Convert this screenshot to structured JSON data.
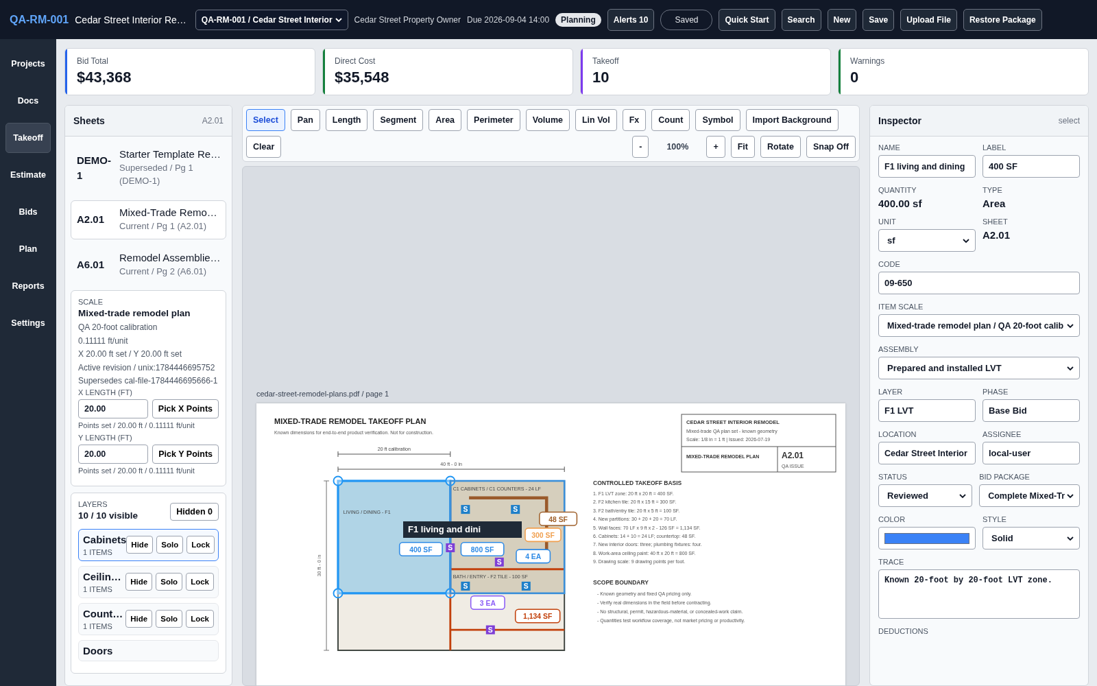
{
  "header": {
    "project_code": "QA-RM-001",
    "project_title": "Cedar Street Interior Re…",
    "project_select": "QA-RM-001 / Cedar Street Interior",
    "owner": "Cedar Street Property Owner",
    "due": "Due 2026-09-04 14:00",
    "phase_badge": "Planning",
    "alerts": "Alerts 10",
    "save_state": "Saved",
    "actions": [
      "Quick Start",
      "Search",
      "New",
      "Save",
      "Upload File",
      "Restore Package"
    ]
  },
  "nav": [
    {
      "label": "Projects",
      "selected": false
    },
    {
      "label": "Docs",
      "selected": false
    },
    {
      "label": "Takeoff",
      "selected": true
    },
    {
      "label": "Estimate",
      "selected": false
    },
    {
      "label": "Bids",
      "selected": false
    },
    {
      "label": "Plan",
      "selected": false
    },
    {
      "label": "Reports",
      "selected": false
    },
    {
      "label": "Settings",
      "selected": false
    }
  ],
  "kpis": [
    {
      "label": "Bid Total",
      "value": "$43,368",
      "color": "#2563eb"
    },
    {
      "label": "Direct Cost",
      "value": "$35,548",
      "color": "#15803d"
    },
    {
      "label": "Takeoff",
      "value": "10",
      "color": "#7c3aed"
    },
    {
      "label": "Warnings",
      "value": "0",
      "color": "#15803d"
    }
  ],
  "sheets": {
    "title": "Sheets",
    "current": "A2.01",
    "items": [
      {
        "code": "DEMO-1",
        "title": "Starter Template Re…",
        "meta": "Superseded / Pg 1 (DEMO-1)",
        "selected": false
      },
      {
        "code": "A2.01",
        "title": "Mixed-Trade Remo…",
        "meta": "Current / Pg 1 (A2.01)",
        "selected": true
      },
      {
        "code": "A6.01",
        "title": "Remodel Assemblie…",
        "meta": "Current / Pg 2 (A6.01)",
        "selected": false
      }
    ]
  },
  "scale": {
    "label": "SCALE",
    "name": "Mixed-trade remodel plan",
    "lines": [
      "QA 20-foot calibration",
      "0.11111 ft/unit",
      "X 20.00 ft set / Y 20.00 ft set",
      "Active revision / unix:1784446695752",
      "Supersedes cal-file-1784446695666-1"
    ],
    "axes": [
      {
        "label": "X LENGTH (FT)",
        "value": "20.00",
        "button": "Pick X Points",
        "status": "Points set / 20.00 ft / 0.11111 ft/unit"
      },
      {
        "label": "Y LENGTH (FT)",
        "value": "20.00",
        "button": "Pick Y Points",
        "status": "Points set / 20.00 ft / 0.11111 ft/unit"
      }
    ]
  },
  "layers": {
    "label": "LAYERS",
    "count": "10 / 10 visible",
    "hidden_button": "Hidden 0",
    "items": [
      {
        "name": "Cabinets",
        "count": "1 ITEMS",
        "selected": true,
        "actions": [
          "Hide",
          "Solo",
          "Lock"
        ]
      },
      {
        "name": "Ceilin…",
        "count": "1 ITEMS",
        "selected": false,
        "actions": [
          "Hide",
          "Solo",
          "Lock"
        ]
      },
      {
        "name": "Count…",
        "count": "1 ITEMS",
        "selected": false,
        "actions": [
          "Hide",
          "Solo",
          "Lock"
        ]
      },
      {
        "name": "Doors",
        "selected": false
      }
    ]
  },
  "toolbar": {
    "tools": [
      {
        "label": "Select",
        "selected": true
      },
      {
        "label": "Pan",
        "selected": false
      },
      {
        "label": "Length",
        "selected": false
      },
      {
        "label": "Segment",
        "selected": false
      },
      {
        "label": "Area",
        "selected": false
      },
      {
        "label": "Perimeter",
        "selected": false
      },
      {
        "label": "Volume",
        "selected": false
      },
      {
        "label": "Lin Vol",
        "selected": false
      },
      {
        "label": "Fx",
        "selected": false
      },
      {
        "label": "Count",
        "selected": false
      },
      {
        "label": "Symbol",
        "selected": false
      },
      {
        "label": "Import Background",
        "selected": false
      }
    ],
    "clear": "Clear",
    "zoom_out": "-",
    "zoom": "100%",
    "zoom_in": "+",
    "view_actions": [
      "Fit",
      "Rotate",
      "Snap Off"
    ]
  },
  "document": {
    "file": "cedar-street-remodel-plans.pdf / page 1",
    "title": "MIXED-TRADE REMODEL TAKEOFF PLAN",
    "subtitle": "Known dimensions for end-to-end product verification. Not for construction.",
    "dimensions": {
      "calibration": "20 ft calibration",
      "width": "40 ft - 0 in",
      "height": "30 ft - 0 in"
    },
    "room_labels": [
      "LIVING / DINING - F1",
      "C1 CABINETS / C1 COUNTERS - 24 LF",
      "BATH / ENTRY - F2 TILE - 100 SF"
    ],
    "title_block": {
      "project": "CEDAR STREET INTERIOR REMODEL",
      "subtitle": "Mixed-trade QA plan set - known geometry",
      "scale": "Scale: 1/8 in = 1 ft | Issued: 2026-07-19",
      "sheet_title": "MIXED-TRADE REMODEL PLAN",
      "sheet_number": "A2.01",
      "issue": "QA ISSUE"
    },
    "notes": {
      "title": "CONTROLLED TAKEOFF BASIS",
      "items": [
        "1. F1 LVT zone: 20 ft x 20 ft = 400 SF.",
        "2. F2 kitchen tile: 20 ft x 15 ft = 300 SF.",
        "3. F2 bath/entry tile: 20 ft x 5 ft = 100 SF.",
        "4. New partitions: 30 + 20 + 20 = 70 LF.",
        "5. Wall faces: 70 LF x 9 ft x 2 - 126 SF = 1,134 SF.",
        "6. Cabinets: 14 + 10 = 24 LF; countertop: 48 SF.",
        "7. New interior doors: three; plumbing fixtures: four.",
        "8. Work-area ceiling paint: 40 ft x 20 ft = 800 SF.",
        "9. Drawing scale: 9 drawing points per foot."
      ]
    },
    "scope": {
      "title": "SCOPE BOUNDARY",
      "items": [
        "- Known geometry and fixed QA pricing only.",
        "- Verify real dimensions in the field before contracting.",
        "- No structural, permit, hazardous-material, or concealed-work claim.",
        "- Quantities test workflow coverage, not market pricing or productivity."
      ]
    },
    "markups": [
      {
        "label": "400 SF",
        "color": "#2f8be6"
      },
      {
        "label": "800 SF",
        "color": "#2f8be6"
      },
      {
        "label": "4 EA",
        "color": "#2f8be6"
      },
      {
        "label": "48 SF",
        "color": "#a0622d"
      },
      {
        "label": "300 SF",
        "color": "#f0a050"
      },
      {
        "label": "3 EA",
        "color": "#8b5cf6"
      },
      {
        "label": "1,134 SF",
        "color": "#c2410c"
      }
    ],
    "symbols": [
      {
        "text": "S",
        "color": "#1e7fc9"
      },
      {
        "text": "S",
        "color": "#1e7fc9"
      },
      {
        "text": "S",
        "color": "#1e7fc9"
      },
      {
        "text": "S",
        "color": "#1e7fc9"
      },
      {
        "text": "S",
        "color": "#7e3fd6"
      },
      {
        "text": "S",
        "color": "#7e3fd6"
      },
      {
        "text": "S",
        "color": "#7e3fd6"
      }
    ],
    "tooltip": "F1 living and dini"
  },
  "inspector": {
    "title": "Inspector",
    "mode": "select",
    "rows": [
      [
        {
          "kind": "input",
          "label": "NAME",
          "value": "F1 living and dining"
        },
        {
          "kind": "input",
          "label": "LABEL",
          "value": "400 SF"
        }
      ],
      [
        {
          "kind": "static",
          "label": "QUANTITY",
          "value": "400.00 sf"
        },
        {
          "kind": "static",
          "label": "TYPE",
          "value": "Area"
        }
      ],
      [
        {
          "kind": "select",
          "label": "UNIT",
          "value": "sf"
        },
        {
          "kind": "static",
          "label": "SHEET",
          "value": "A2.01"
        }
      ],
      [
        {
          "kind": "input",
          "label": "CODE",
          "value": "09-650"
        }
      ],
      [
        {
          "kind": "select",
          "label": "ITEM SCALE",
          "value": "Mixed-trade remodel plan / QA 20-foot calib"
        }
      ],
      [
        {
          "kind": "select",
          "label": "ASSEMBLY",
          "value": "Prepared and installed LVT"
        }
      ],
      [
        {
          "kind": "input",
          "label": "LAYER",
          "value": "F1 LVT"
        },
        {
          "kind": "input",
          "label": "PHASE",
          "value": "Base Bid"
        }
      ],
      [
        {
          "kind": "input",
          "label": "LOCATION",
          "value": "Cedar Street Interior"
        },
        {
          "kind": "input",
          "label": "ASSIGNEE",
          "value": "local-user"
        }
      ],
      [
        {
          "kind": "select",
          "label": "STATUS",
          "value": "Reviewed"
        },
        {
          "kind": "select",
          "label": "BID PACKAGE",
          "value": "Complete Mixed-Tr"
        }
      ],
      [
        {
          "kind": "color",
          "label": "COLOR",
          "color": "#3b82f6"
        },
        {
          "kind": "select",
          "label": "STYLE",
          "value": "Solid"
        }
      ],
      [
        {
          "kind": "textarea",
          "label": "TRACE",
          "value": "Known 20-foot by 20-foot LVT zone."
        }
      ],
      [
        {
          "kind": "heading",
          "label": "DEDUCTIONS"
        }
      ]
    ]
  }
}
